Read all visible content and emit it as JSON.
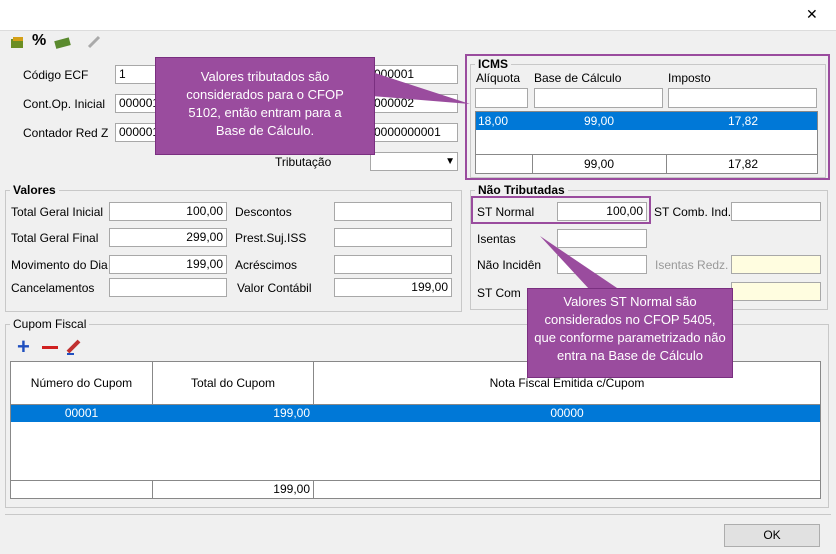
{
  "window": {
    "close_glyph": "✕"
  },
  "toolbar": {
    "icons": [
      "calc-icon",
      "percent-icon",
      "money-icon",
      "edit-icon"
    ]
  },
  "header": {
    "codigo_ecf_label": "Código ECF",
    "codigo_ecf_value": "1",
    "contop_label": "Cont.Op. Inicial",
    "contop_value": "000001",
    "contador_label": "Contador Red Z",
    "contador_value": "000001",
    "right1_value": "000001",
    "right2_value": "000002",
    "right3_value": "0000000001",
    "tributacao_label": "Tributação",
    "tributacao_value": ""
  },
  "icms": {
    "title": "ICMS",
    "col_aliquota": "Alíquota",
    "col_base": "Base de Cálculo",
    "col_imposto": "Imposto",
    "row": {
      "aliquota": "18,00",
      "base": "99,00",
      "imposto": "17,82"
    },
    "total": {
      "base": "99,00",
      "imposto": "17,82"
    }
  },
  "valores": {
    "title": "Valores",
    "total_geral_inicial_label": "Total Geral Inicial",
    "total_geral_inicial_value": "100,00",
    "total_geral_final_label": "Total Geral Final",
    "total_geral_final_value": "299,00",
    "movimento_label": "Movimento do Dia",
    "movimento_value": "199,00",
    "cancelamentos_label": "Cancelamentos",
    "cancelamentos_value": "",
    "descontos_label": "Descontos",
    "descontos_value": "",
    "prest_label": "Prest.Suj.ISS",
    "prest_value": "",
    "acrescimos_label": "Acréscimos",
    "acrescimos_value": "",
    "valor_contabil_label": "Valor Contábil",
    "valor_contabil_value": "199,00"
  },
  "nao_tributadas": {
    "title": "Não Tributadas",
    "st_normal_label": "ST Normal",
    "st_normal_value": "100,00",
    "st_comb_label": "ST Comb. Ind.",
    "isentas_label": "Isentas",
    "nao_incid_label": "Não Incidên",
    "isentas_redz_label": "Isentas Redz.",
    "st_com_label": "ST Com"
  },
  "cupom": {
    "title": "Cupom Fiscal",
    "col_numero": "Número do Cupom",
    "col_total": "Total do Cupom",
    "col_nota": "Nota Fiscal Emitida c/Cupom",
    "row": {
      "numero": "00001",
      "total": "199,00",
      "nota": "00000"
    },
    "footer_total": "199,00"
  },
  "notes": {
    "note1": "Valores tributados são considerados para o CFOP 5102, então entram para a Base de Cálculo.",
    "note2": "Valores ST Normal são considerados no CFOP 5405, que conforme parametrizado não entra na Base de Cálculo"
  },
  "ok_label": "OK",
  "colors": {
    "accent": "#0078d7",
    "annotation": "#9a4c9e"
  }
}
